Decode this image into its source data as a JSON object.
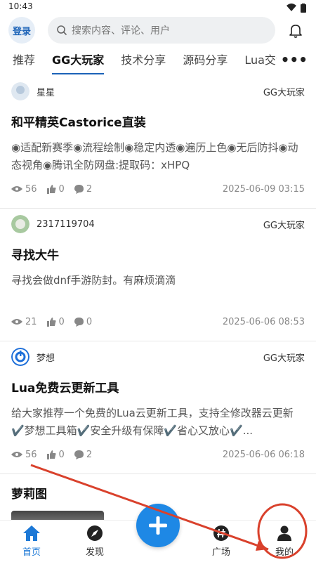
{
  "status": {
    "time": "10:43"
  },
  "header": {
    "login_label": "登录",
    "search_placeholder": "搜索内容、评论、用户"
  },
  "tabs": [
    "推荐",
    "GG大玩家",
    "技术分享",
    "源码分享",
    "Lua交流"
  ],
  "posts": [
    {
      "author": "星星",
      "board": "GG大玩家",
      "title": "和平精英Castorice直装",
      "body": "◉适配新赛季◉流程绘制◉稳定内透◉遍历上色◉无后防抖◉动态视角◉腾讯全防网盘:提取码：xHPQ",
      "views": "56",
      "likes": "0",
      "comments": "2",
      "time": "2025-06-09 03:15"
    },
    {
      "author": "2317119704",
      "board": "GG大玩家",
      "title": "寻找大牛",
      "body": "寻找会做dnf手游防封。有麻烦滴滴",
      "views": "21",
      "likes": "0",
      "comments": "0",
      "time": "2025-06-06 08:53"
    },
    {
      "author": "梦想",
      "board": "GG大玩家",
      "title": "Lua免费云更新工具",
      "body": "给大家推荐一个免费的Lua云更新工具，支持全修改器云更新✔️梦想工具箱✔️安全升级有保障✔️省心又放心✔️...",
      "views": "56",
      "likes": "0",
      "comments": "2",
      "time": "2025-06-06 06:18"
    },
    {
      "title": "萝莉图"
    }
  ],
  "nav": {
    "home": "首页",
    "discover": "发现",
    "square": "广场",
    "mine": "我的"
  },
  "colors": {
    "accent": "#1e88e5",
    "annotation": "#d9412c"
  }
}
